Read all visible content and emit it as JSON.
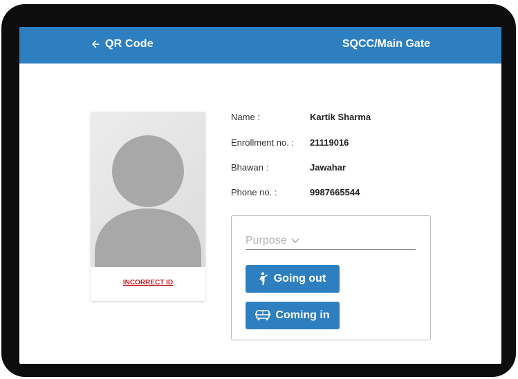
{
  "appbar": {
    "back_label": "QR Code",
    "location": "SQCC/Main Gate",
    "color": "#2e7fbf"
  },
  "profile": {
    "avatar_icon": "person-silhouette-icon",
    "incorrect_id_label": "INCORRECT ID",
    "fields": [
      {
        "label": "Name :",
        "value": "Kartik Sharma"
      },
      {
        "label": "Enrollment no. :",
        "value": "21119016"
      },
      {
        "label": "Bhawan :",
        "value": "Jawahar"
      },
      {
        "label": "Phone no. :",
        "value": "9987665544"
      }
    ]
  },
  "actions": {
    "purpose_placeholder": "Purpose",
    "going_out_label": "Going out",
    "coming_in_label": "Coming in",
    "going_out_icon": "person-walking-icon",
    "coming_in_icon": "bus-icon"
  }
}
